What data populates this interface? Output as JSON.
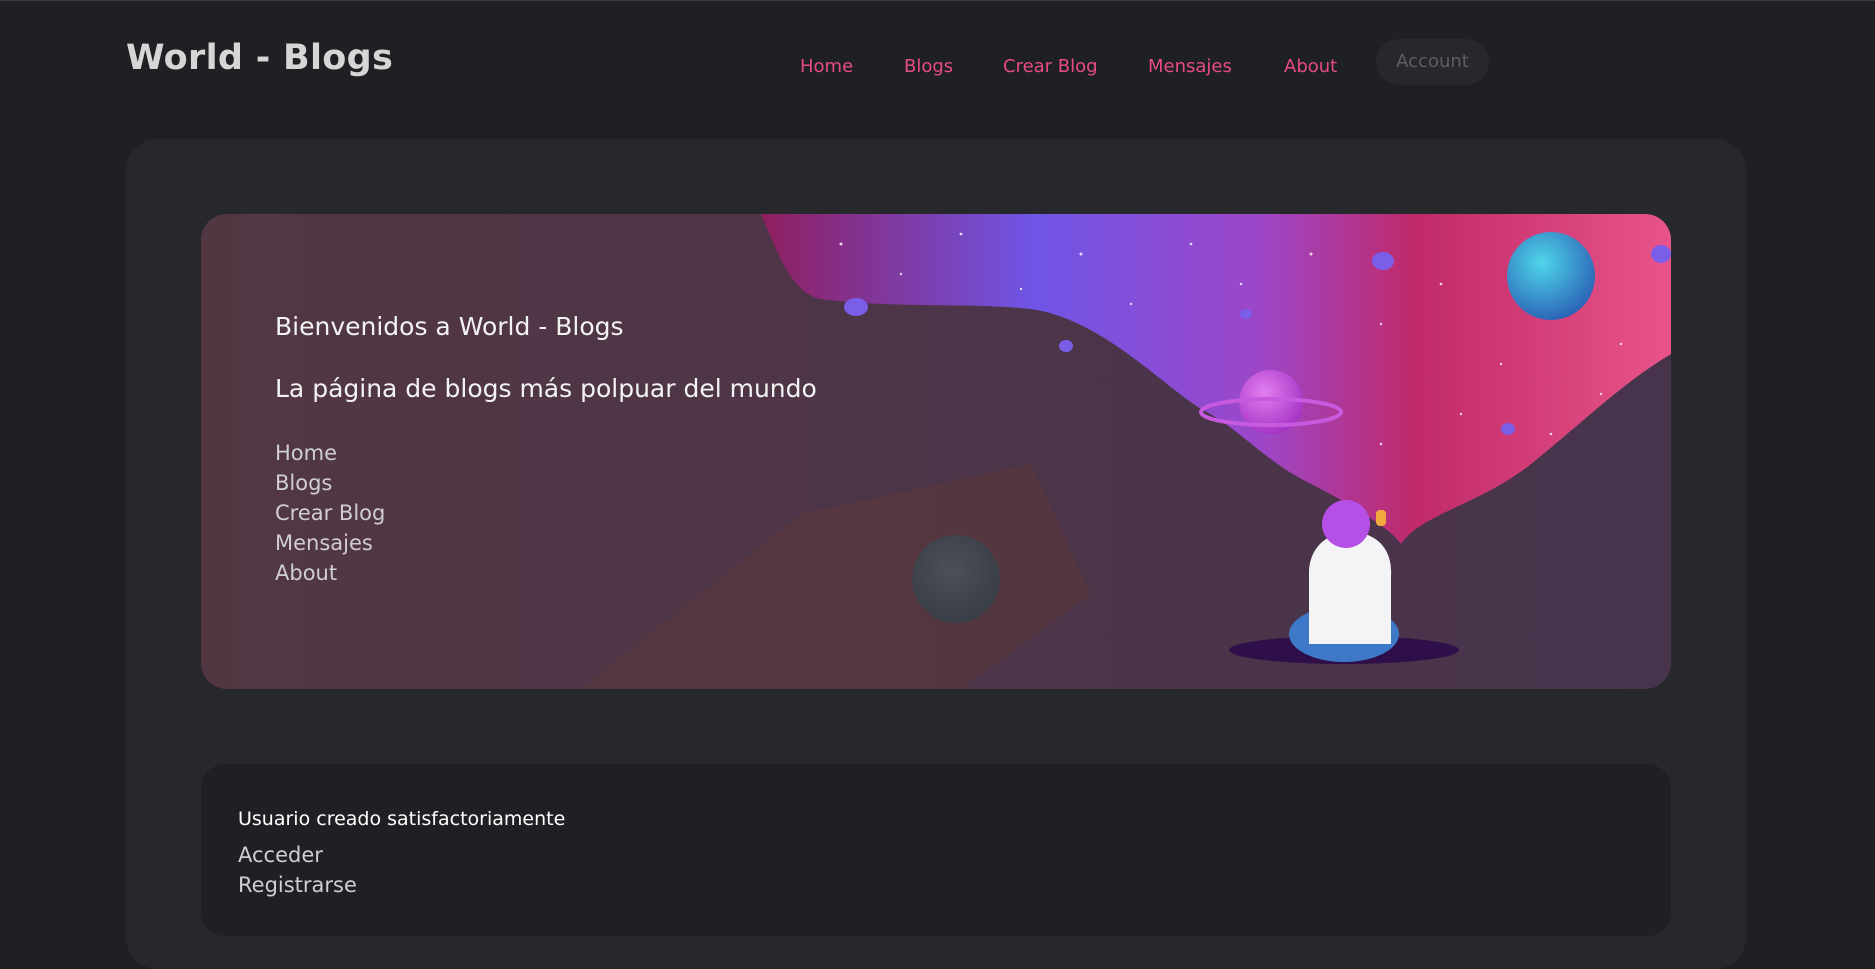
{
  "header": {
    "brand": "World - Blogs",
    "nav": [
      "Home",
      "Blogs",
      "Crear Blog",
      "Mensajes",
      "About"
    ],
    "account_label": "Account"
  },
  "hero": {
    "title": "Bienvenidos a World - Blogs",
    "subtitle": "La página de blogs más polpuar del mundo",
    "links": [
      "Home",
      "Blogs",
      "Crear Blog",
      "Mensajes",
      "About"
    ]
  },
  "message": {
    "text": "Usuario creado satisfactoriamente",
    "links": [
      "Acceder",
      "Registrarse"
    ]
  },
  "colors": {
    "accent": "#e84b83",
    "background": "#1f2023",
    "card": "#27282b"
  }
}
